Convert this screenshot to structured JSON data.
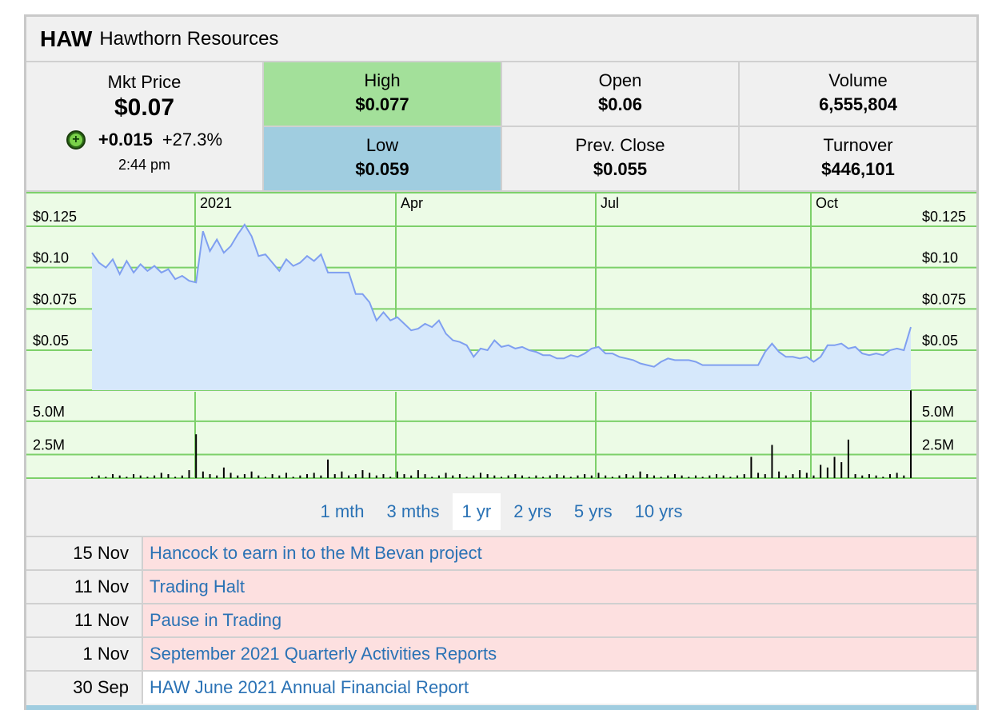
{
  "header": {
    "code": "HAW",
    "name": "Hawthorn Resources"
  },
  "quote": {
    "mkt_price_label": "Mkt Price",
    "mkt_price": "$0.07",
    "change_icon": "plus-circle-icon",
    "change": "+0.015",
    "change_pct": "+27.3%",
    "time": "2:44 pm",
    "high_label": "High",
    "high": "$0.077",
    "low_label": "Low",
    "low": "$0.059",
    "open_label": "Open",
    "open": "$0.06",
    "prev_close_label": "Prev. Close",
    "prev_close": "$0.055",
    "volume_label": "Volume",
    "volume": "6,555,804",
    "turnover_label": "Turnover",
    "turnover": "$446,101"
  },
  "colors": {
    "high_bg": "#a3e09a",
    "low_bg": "#a0cde0",
    "chart_bg": "#ecfbe6",
    "grid": "#7dd06a",
    "price_line": "#7f9ff0",
    "price_fill": "#d6e8fb",
    "link": "#2a72b5",
    "news_bg": "#fde0e0"
  },
  "chart_data": {
    "type": "area",
    "x_ticks": [
      "2021",
      "Apr",
      "Jul",
      "Oct"
    ],
    "price_ticks": [
      "$0.125",
      "$0.10",
      "$0.075",
      "$0.05"
    ],
    "volume_ticks": [
      "5.0M",
      "2.5M"
    ],
    "price_ylim": [
      0.02,
      0.14
    ],
    "volume_ylim": [
      0,
      6.5
    ],
    "series": [
      {
        "values": [
          0.109,
          0.103,
          0.1,
          0.105,
          0.096,
          0.104,
          0.097,
          0.102,
          0.098,
          0.101,
          0.097,
          0.099,
          0.093,
          0.095,
          0.092,
          0.091,
          0.122,
          0.11,
          0.117,
          0.109,
          0.113,
          0.12,
          0.126,
          0.119,
          0.107,
          0.108,
          0.103,
          0.098,
          0.105,
          0.101,
          0.103,
          0.107,
          0.104,
          0.108,
          0.097,
          0.097,
          0.097,
          0.097,
          0.084,
          0.084,
          0.079,
          0.068,
          0.073,
          0.068,
          0.07,
          0.066,
          0.062,
          0.063,
          0.066,
          0.064,
          0.068,
          0.06,
          0.056,
          0.055,
          0.053,
          0.046,
          0.051,
          0.05,
          0.056,
          0.052,
          0.053,
          0.051,
          0.052,
          0.05,
          0.049,
          0.047,
          0.047,
          0.045,
          0.045,
          0.047,
          0.046,
          0.048,
          0.051,
          0.052,
          0.048,
          0.048,
          0.046,
          0.045,
          0.044,
          0.042,
          0.041,
          0.04,
          0.043,
          0.045,
          0.044,
          0.044,
          0.044,
          0.043,
          0.041,
          0.041,
          0.041,
          0.041,
          0.041,
          0.041,
          0.041,
          0.041,
          0.041,
          0.049,
          0.054,
          0.049,
          0.046,
          0.046,
          0.045,
          0.046,
          0.043,
          0.046,
          0.053,
          0.053,
          0.054,
          0.051,
          0.052,
          0.048,
          0.047,
          0.048,
          0.047,
          0.05,
          0.051,
          0.05,
          0.064
        ]
      }
    ],
    "volume_m": [
      0.1,
      0.2,
      0.1,
      0.3,
      0.2,
      0.1,
      0.3,
      0.2,
      0.1,
      0.2,
      0.4,
      0.3,
      0.1,
      0.2,
      0.6,
      3.3,
      0.5,
      0.3,
      0.2,
      0.8,
      0.4,
      0.2,
      0.3,
      0.5,
      0.2,
      0.1,
      0.3,
      0.2,
      0.4,
      0.1,
      0.2,
      0.3,
      0.4,
      0.2,
      1.4,
      0.3,
      0.5,
      0.2,
      0.3,
      0.6,
      0.4,
      0.2,
      0.3,
      0.1,
      0.5,
      0.3,
      0.2,
      0.6,
      0.3,
      0.1,
      0.2,
      0.4,
      0.2,
      0.3,
      0.1,
      0.2,
      0.4,
      0.3,
      0.2,
      0.1,
      0.2,
      0.3,
      0.2,
      0.1,
      0.2,
      0.1,
      0.2,
      0.3,
      0.2,
      0.1,
      0.2,
      0.3,
      0.2,
      0.4,
      0.2,
      0.1,
      0.2,
      0.3,
      0.2,
      0.5,
      0.3,
      0.2,
      0.1,
      0.2,
      0.3,
      0.2,
      0.1,
      0.2,
      0.1,
      0.2,
      0.3,
      0.2,
      0.1,
      0.2,
      0.3,
      1.6,
      0.4,
      0.3,
      2.5,
      0.5,
      0.2,
      0.3,
      0.6,
      0.4,
      0.2,
      1.0,
      0.8,
      1.6,
      1.2,
      2.9,
      0.3,
      0.2,
      0.3,
      0.2,
      0.1,
      0.3,
      0.4,
      0.2,
      6.6
    ]
  },
  "ranges": [
    "1 mth",
    "3 mths",
    "1 yr",
    "2 yrs",
    "5 yrs",
    "10 yrs"
  ],
  "active_range": "1 yr",
  "news": [
    {
      "date": "15 Nov",
      "title": "Hancock to earn in to the Mt Bevan project"
    },
    {
      "date": "11 Nov",
      "title": "Trading Halt"
    },
    {
      "date": "11 Nov",
      "title": "Pause in Trading"
    },
    {
      "date": "1 Nov",
      "title": "September 2021 Quarterly Activities Reports"
    },
    {
      "date": "30 Sep",
      "title": "HAW June 2021 Annual Financial Report"
    }
  ]
}
